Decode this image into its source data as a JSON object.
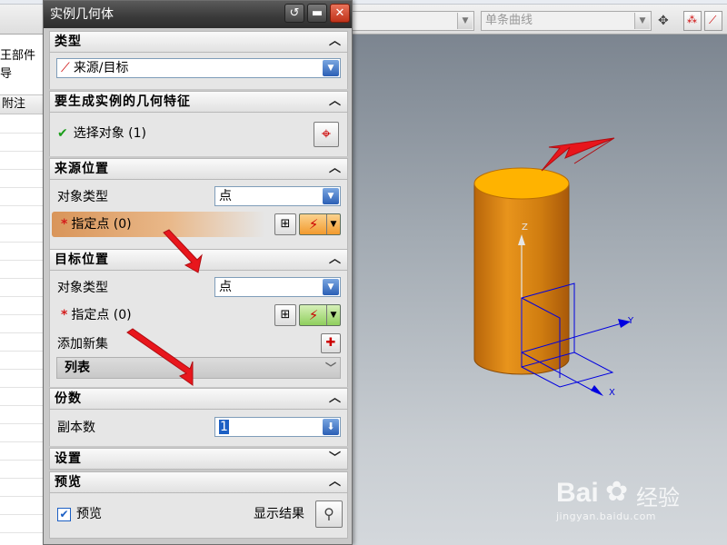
{
  "background": {
    "part_nav_header_fragment": "王部件导",
    "annotation_column_header": "附注",
    "curve_rule_combo": "单条曲线"
  },
  "dialog": {
    "title": "实例几何体",
    "type_section": {
      "title": "类型",
      "dropdown_value": "来源/目标"
    },
    "geometry_section": {
      "title": "要生成实例的几何特征",
      "select_object_label": "选择对象 (1)"
    },
    "source_section": {
      "title": "来源位置",
      "object_type_label": "对象类型",
      "object_type_value": "点",
      "specify_point_label": "指定点 (0)"
    },
    "target_section": {
      "title": "目标位置",
      "object_type_label": "对象类型",
      "object_type_value": "点",
      "specify_point_label": "指定点 (0)",
      "add_new_set_label": "添加新集",
      "list_label": "列表"
    },
    "copies_section": {
      "title": "份数",
      "copies_label": "副本数",
      "copies_value": "1"
    },
    "settings_section": {
      "title": "设置"
    },
    "preview_section": {
      "title": "预览",
      "preview_checkbox_label": "预览",
      "preview_checked": true,
      "show_result_label": "显示结果"
    }
  },
  "viewport": {
    "axis_z": "Z",
    "axis_y": "Y",
    "axis_x": "X",
    "cylinder_color": "#d9860e",
    "cylinder_top_color": "#ffb300",
    "axis_color": "#0000e0"
  },
  "watermark": {
    "brand": "Bai",
    "brand_suffix": "经验",
    "url": "jingyan.baidu.com"
  },
  "colors": {
    "annotation_arrow": "#e8161c",
    "title_bar": "#3a3a3a",
    "highlight_row": "#e7b27c"
  }
}
